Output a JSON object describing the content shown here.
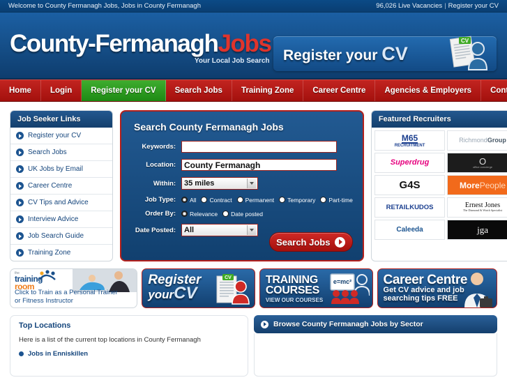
{
  "topbar": {
    "welcome": "Welcome to County Fermanagh Jobs, Jobs in County Fermanagh",
    "vacancies": "96,026 Live Vacancies",
    "separator": "|",
    "register_cv": "Register your CV"
  },
  "header": {
    "logo_primary": "County-Fermanagh",
    "logo_accent": "Jobs",
    "tagline": "Your Local Job Search",
    "cv_banner_text": "Register your",
    "cv_banner_bold": "CV",
    "cv_doc_label": "CV"
  },
  "nav": {
    "items": [
      {
        "label": "Home",
        "active": false
      },
      {
        "label": "Login",
        "active": false
      },
      {
        "label": "Register your CV",
        "active": true
      },
      {
        "label": "Search Jobs",
        "active": false
      },
      {
        "label": "Training Zone",
        "active": false
      },
      {
        "label": "Career Centre",
        "active": false
      },
      {
        "label": "Agencies & Employers",
        "active": false
      },
      {
        "label": "Contact Us",
        "active": false
      }
    ]
  },
  "sidebar": {
    "title": "Job Seeker Links",
    "items": [
      {
        "label": "Register your CV"
      },
      {
        "label": "Search Jobs"
      },
      {
        "label": "UK Jobs by Email"
      },
      {
        "label": "Career Centre"
      },
      {
        "label": "CV Tips and Advice"
      },
      {
        "label": "Interview Advice"
      },
      {
        "label": "Job Search Guide"
      },
      {
        "label": "Training Zone"
      }
    ]
  },
  "search": {
    "title": "Search County Fermanagh Jobs",
    "keywords_label": "Keywords:",
    "keywords_value": "",
    "keywords_placeholder": "",
    "location_label": "Location:",
    "location_value": "County Fermanagh",
    "within_label": "Within:",
    "within_value": "35 miles",
    "jobtype_label": "Job Type:",
    "jobtype_options": [
      {
        "label": "All",
        "selected": true
      },
      {
        "label": "Contract",
        "selected": false
      },
      {
        "label": "Permanent",
        "selected": false
      },
      {
        "label": "Temporary",
        "selected": false
      },
      {
        "label": "Part-time",
        "selected": false
      }
    ],
    "orderby_label": "Order By:",
    "orderby_options": [
      {
        "label": "Relevance",
        "selected": true
      },
      {
        "label": "Date posted",
        "selected": false
      }
    ],
    "dateposted_label": "Date Posted:",
    "dateposted_value": "All",
    "submit_label": "Search Jobs"
  },
  "recruiters": {
    "title": "Featured Recruiters",
    "items": [
      {
        "name": "M65 RECRUITMENT",
        "line1": "M65",
        "line2": "RECRUITMENT",
        "fg": "#1b3f8f",
        "bg": "#ffffff"
      },
      {
        "name": "Richmond Group",
        "line1": "Richmond",
        "line2": "Group",
        "fg": "#8a99a8",
        "bg": "#ffffff"
      },
      {
        "name": "Superdrug",
        "line1": "Superdrug",
        "line2": "",
        "fg": "#e6007e",
        "bg": "#ffffff"
      },
      {
        "name": "office concierge",
        "line1": "O",
        "line2": "office concierge",
        "fg": "#ffffff",
        "bg": "#1c1c1c"
      },
      {
        "name": "G4S",
        "line1": "G4S",
        "line2": "",
        "fg": "#111111",
        "bg": "#ffffff"
      },
      {
        "name": "MorePeople",
        "line1": "More",
        "line2": "People",
        "fg": "#ffffff",
        "bg": "#f26a1b"
      },
      {
        "name": "RETAILKUDOS",
        "line1": "RETAILKUDOS",
        "line2": "",
        "fg": "#1b3f8f",
        "bg": "#ffffff"
      },
      {
        "name": "Ernest Jones",
        "line1": "Ernest Jones",
        "line2": "The Diamond & Watch Specialist",
        "fg": "#111111",
        "bg": "#ffffff"
      },
      {
        "name": "Caleeda",
        "line1": "Caleeda",
        "line2": "",
        "fg": "#1b5490",
        "bg": "#ffffff"
      },
      {
        "name": "jga",
        "line1": "jga",
        "line2": "",
        "fg": "#ffffff",
        "bg": "#0a0a0a"
      }
    ]
  },
  "promos": [
    {
      "name": "training-room",
      "logo_line1": "the",
      "logo_line2": "training",
      "logo_line3": "room",
      "text_line1": "Click to Train as a Personal Trainer",
      "text_line2": "or Fitness Instructor"
    },
    {
      "name": "register-your-cv",
      "text_line1": "Register",
      "text_line2": "your",
      "text_bold": "CV",
      "doc_label": "CV"
    },
    {
      "name": "training-courses",
      "text_line1": "TRAINING",
      "text_line2": "COURSES",
      "text_line3": "VIEW OUR  COURSES",
      "board_label": "e=mc²"
    },
    {
      "name": "career-centre",
      "text_line1": "Career Centre",
      "text_line2": "Get CV advice and job",
      "text_line3": "searching tips FREE"
    }
  ],
  "top_locations": {
    "title": "Top Locations",
    "description": "Here is a list of the current top locations in County Fermanagh",
    "items": [
      {
        "label": "Jobs in Enniskillen"
      }
    ]
  },
  "browse_sector": {
    "title": "Browse County Fermanagh Jobs by Sector"
  },
  "colors": {
    "brand_blue": "#14457c",
    "brand_red": "#b3201c",
    "nav_red": "#a3100d",
    "nav_active_green": "#1d8a14",
    "topbar_blue": "#0a3e72"
  }
}
